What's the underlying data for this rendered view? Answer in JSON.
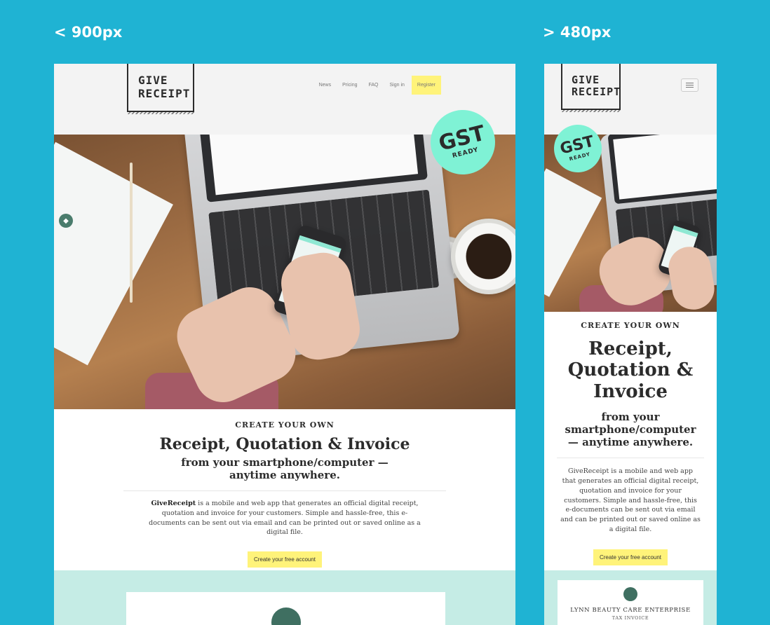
{
  "breakpoints": {
    "desktop_label": "< 900px",
    "mobile_label": "> 480px"
  },
  "logo": {
    "line1": "GIVE",
    "line2": "RECEIPT"
  },
  "nav": {
    "news": "News",
    "pricing": "Pricing",
    "faq": "FAQ",
    "signin": "Sign in",
    "register": "Register"
  },
  "badge": {
    "main": "GST",
    "sub": "READY"
  },
  "content": {
    "eyebrow": "CREATE YOUR OWN",
    "headline": "Receipt, Quotation & Invoice",
    "subhead": "from your smartphone/computer — anytime anywhere.",
    "brand": "GiveReceipt",
    "body_desktop": " is a mobile and web app that generates an official digital receipt, quotation and invoice for your customers. Simple and hassle-free, this e-documents can be sent out via email and can be printed out or saved online as a digital file.",
    "body_mobile": "GiveReceipt is a mobile and web app that generates an official digital receipt, quotation and invoice for your customers. Simple and hassle-free, this e-documents can be sent out via email and can be printed out or saved online as a digital file.",
    "cta": "Create your free account"
  },
  "card": {
    "title": "LYNN BEAUTY CARE ENTERPRISE",
    "subtitle": "TAX INVOICE"
  },
  "colors": {
    "background": "#1fb3d3",
    "accent_yellow": "#fff37a",
    "mint": "#7ff2d5",
    "mint_band": "#c5ece5"
  },
  "icons": {
    "menu": "hamburger-menu-icon",
    "gst": "gst-badge-icon",
    "card": "receipt-logo-icon"
  }
}
